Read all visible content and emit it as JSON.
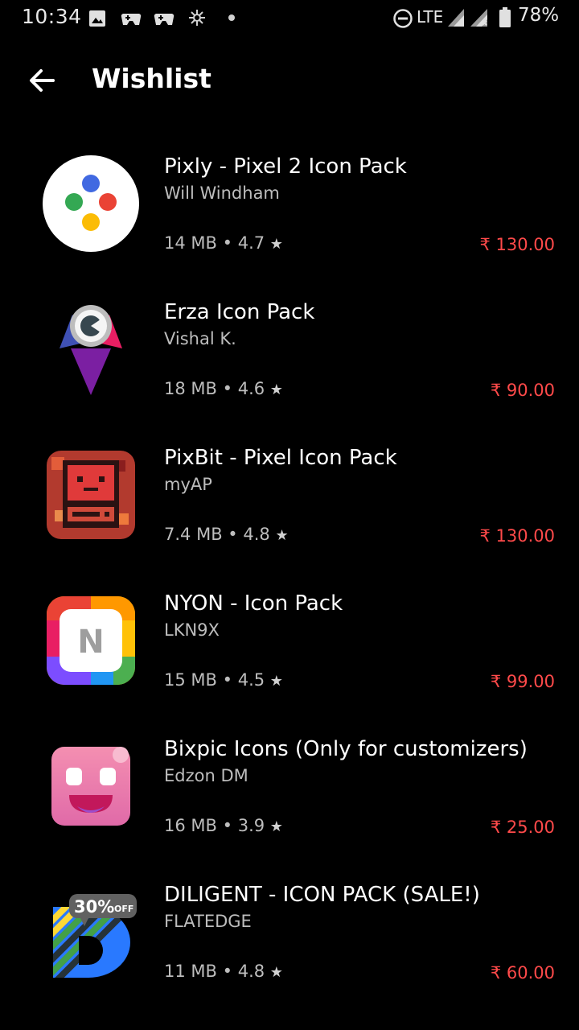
{
  "status_bar": {
    "time": "10:34",
    "network": "LTE",
    "battery": "78%",
    "icons": [
      "image-icon",
      "game-controller-icon",
      "game-controller-icon",
      "burst-icon",
      "dot-icon",
      "dnd-icon",
      "signal-icon",
      "signal-x-icon",
      "battery-icon"
    ]
  },
  "app_bar": {
    "title": "Wishlist",
    "back_icon": "arrow-left-icon"
  },
  "apps": [
    {
      "name": "Pixly - Pixel 2 Icon Pack",
      "developer": "Will Windham",
      "size": "14 MB",
      "rating": "4.7",
      "price": "₹ 130.00",
      "icon": "pixly-icon"
    },
    {
      "name": "Erza Icon Pack",
      "developer": "Vishal K.",
      "size": "18 MB",
      "rating": "4.6",
      "price": "₹ 90.00",
      "icon": "erza-icon"
    },
    {
      "name": "PixBit - Pixel Icon Pack",
      "developer": "myAP",
      "size": "7.4 MB",
      "rating": "4.8",
      "price": "₹ 130.00",
      "icon": "pixbit-icon"
    },
    {
      "name": "NYON - Icon Pack",
      "developer": "LKN9X",
      "size": "15 MB",
      "rating": "4.5",
      "price": "₹ 99.00",
      "icon": "nyon-icon",
      "icon_letter": "N"
    },
    {
      "name": "Bixpic Icons (Only for customizers)",
      "developer": "Edzon DM",
      "size": "16 MB",
      "rating": "3.9",
      "price": "₹ 25.00",
      "icon": "bixpic-icon"
    },
    {
      "name": "DILIGENT - ICON PACK (SALE!)",
      "developer": "FLATEDGE",
      "size": "11 MB",
      "rating": "4.8",
      "price": "₹ 60.00",
      "icon": "diligent-icon",
      "badge": "30%",
      "badge_suffix": "OFF"
    }
  ],
  "separator": "•",
  "star": "★",
  "colors": {
    "background": "#000000",
    "price": "#ff4a4a",
    "secondary_text": "#bdbdbd"
  }
}
